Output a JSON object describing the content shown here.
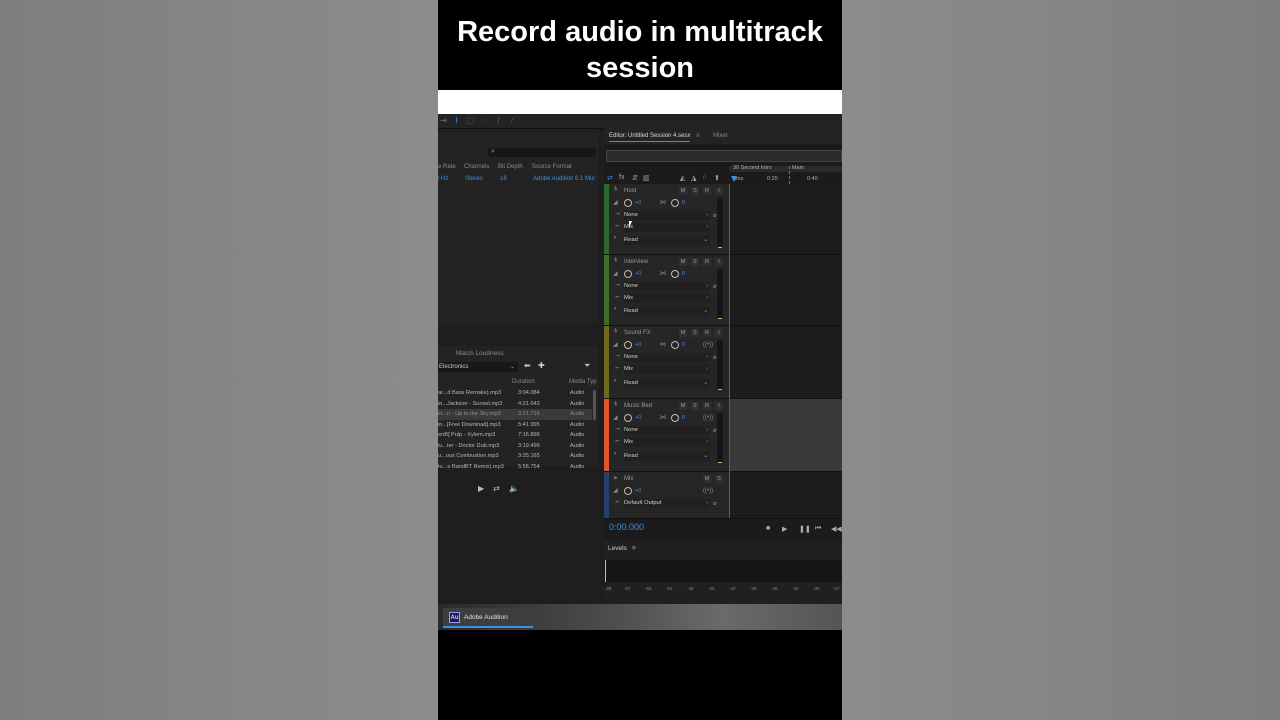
{
  "caption": "Record audio in multitrack session",
  "files": {
    "headers": [
      "e Rate",
      "Channels",
      "Bit Depth",
      "Source Format"
    ],
    "row": [
      "l Hz",
      "Stereo",
      "16",
      "Adobe Audition 6.1 Mul"
    ]
  },
  "media": {
    "title": "Match Loudness",
    "category": "Electronics",
    "headers": [
      "Duration",
      "Media Typ"
    ],
    "rows": [
      {
        "name": "ar...d Bass Remake).mp3",
        "duration": "3:04.084",
        "type": "Audio"
      },
      {
        "name": "in...Jackson - Sunset.mp3",
        "duration": "4:21.642",
        "type": "Audio"
      },
      {
        "name": "in...n - Up to the Sky.mp3",
        "duration": "3:21.716",
        "type": "Audio"
      },
      {
        "name": "in...[Free Download].mp3",
        "duration": "5:41.995",
        "type": "Audio"
      },
      {
        "name": "enB] Pulp - Xylem.mp3",
        "duration": "7:16.896",
        "type": "Audio"
      },
      {
        "name": "iu...ter - Doctor Dub.mp3",
        "duration": "3:19.496",
        "type": "Audio"
      },
      {
        "name": "u...ous Combustion.mp3",
        "duration": "3:25.165",
        "type": "Audio"
      },
      {
        "name": "tu...e BandBT Remix).mp3",
        "duration": "5:56.754",
        "type": "Audio"
      }
    ]
  },
  "editor": {
    "tab_editor": "Editor: Untitled Session 4.sesx",
    "tab_menu": "≡",
    "tab_mixer": "Mixer",
    "marker_label": "30 Second Intro",
    "marker_label2": "Main",
    "ruler": [
      "hms",
      "0:20",
      "0:40"
    ],
    "time": "0:00.000"
  },
  "tracks": [
    {
      "name": "Host",
      "vol": "+0",
      "pan": "0",
      "input": "None",
      "output": "Mix",
      "mode": "Read",
      "color": "#2e6a2e"
    },
    {
      "name": "Interview",
      "vol": "+0",
      "pan": "0",
      "input": "None",
      "output": "Mix",
      "mode": "Read",
      "color": "#3c6e2a"
    },
    {
      "name": "Sound FX",
      "vol": "+0",
      "pan": "0",
      "input": "None",
      "output": "Mix",
      "mode": "Read",
      "color": "#6e6a1e"
    },
    {
      "name": "Music Bed",
      "vol": "+0",
      "pan": "0",
      "input": "None",
      "output": "Mix",
      "mode": "Read",
      "color": "#e0552a"
    }
  ],
  "mix_track": {
    "name": "Mix",
    "vol": "+0",
    "output": "Default Output",
    "color": "#2a3e6e"
  },
  "levels": {
    "title": "Levels",
    "menu": "≡",
    "ticks": [
      "dB",
      "-57",
      "-54",
      "-51",
      "-48",
      "-45",
      "-42",
      "-39",
      "-36",
      "-33",
      "-30",
      "-27"
    ]
  },
  "taskbar": {
    "app_label": "Adobe Audition",
    "logo": "Au"
  }
}
